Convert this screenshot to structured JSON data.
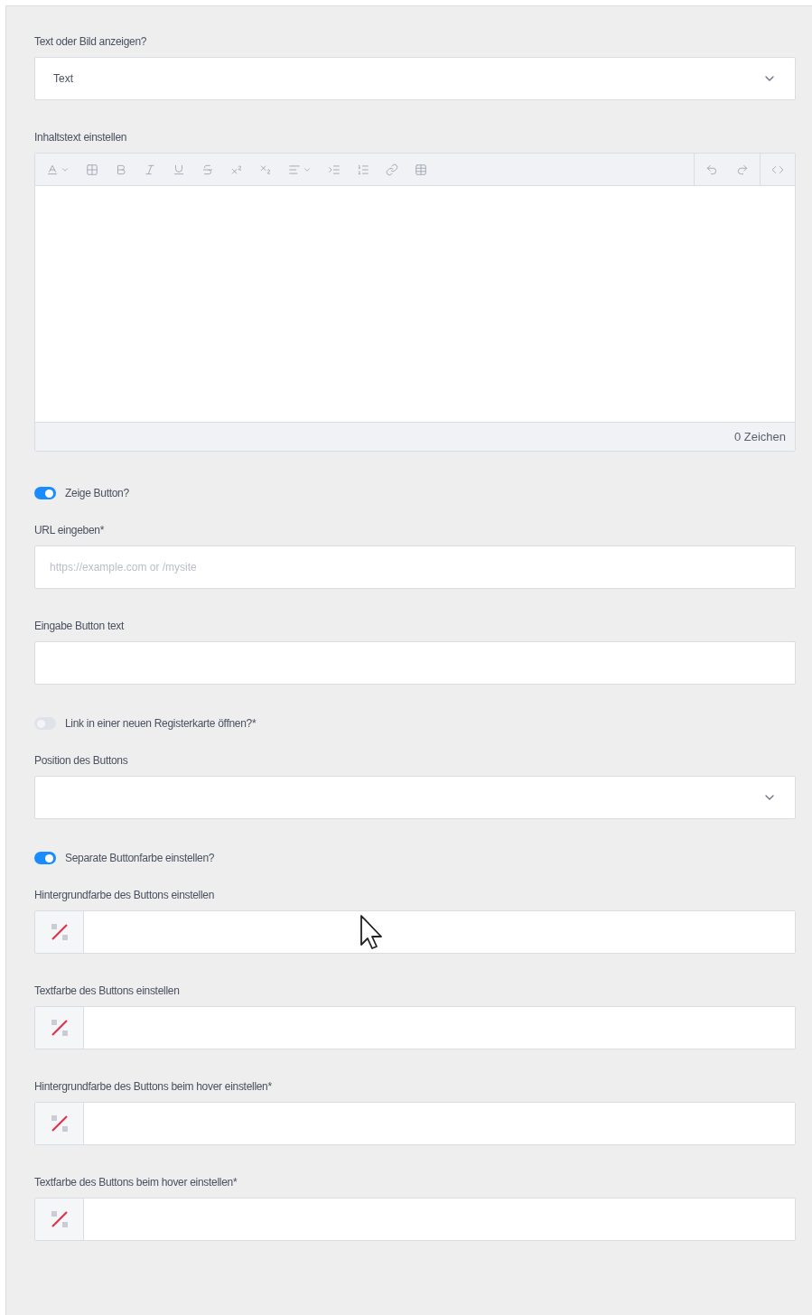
{
  "fields": [
    {
      "kind": "select",
      "label": "Text oder Bild anzeigen?",
      "value": "Text"
    },
    {
      "kind": "editor",
      "label": "Inhaltstext einstellen",
      "counter": "0 Zeichen"
    },
    {
      "kind": "toggle",
      "label": "Zeige Button?",
      "on": true
    },
    {
      "kind": "text",
      "label": "URL eingeben*",
      "placeholder": "https://example.com or /mysite"
    },
    {
      "kind": "text",
      "label": "Eingabe Button text"
    },
    {
      "kind": "toggle",
      "label": "Link in einer neuen Registerkarte öffnen?*",
      "on": false
    },
    {
      "kind": "select",
      "label": "Position des Buttons"
    },
    {
      "kind": "toggle",
      "label": "Separate Buttonfarbe einstellen?",
      "on": true
    },
    {
      "kind": "color",
      "label": "Hintergrundfarbe des Buttons einstellen"
    },
    {
      "kind": "color",
      "label": "Textfarbe des Buttons einstellen"
    },
    {
      "kind": "color",
      "label": "Hintergrundfarbe des Buttons beim hover einstellen*"
    },
    {
      "kind": "color",
      "label": "Textfarbe des Buttons beim hover einstellen*"
    }
  ]
}
